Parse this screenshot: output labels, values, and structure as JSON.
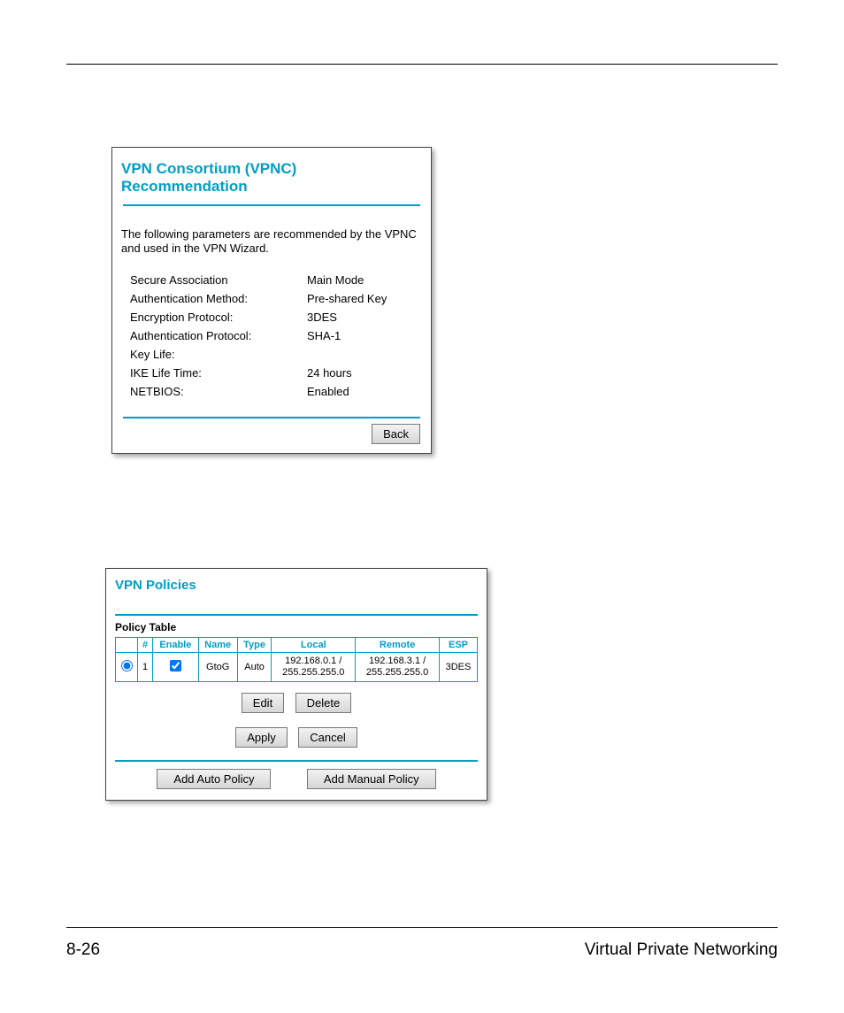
{
  "pageNumber": "8-26",
  "pageTitle": "Virtual Private Networking",
  "vpnc": {
    "title": "VPN Consortium (VPNC) Recommendation",
    "intro": "The following parameters are recommended by the VPNC and used in the VPN Wizard.",
    "rows": [
      {
        "k": "Secure Association",
        "v": "Main Mode"
      },
      {
        "k": "Authentication Method:",
        "v": "Pre-shared Key"
      },
      {
        "k": "Encryption Protocol:",
        "v": "3DES"
      },
      {
        "k": "Authentication Protocol:",
        "v": "SHA-1"
      },
      {
        "k": "Key Life:",
        "v": ""
      },
      {
        "k": "IKE Life Time:",
        "v": "24 hours"
      },
      {
        "k": "NETBIOS:",
        "v": "Enabled"
      }
    ],
    "back": "Back"
  },
  "policies": {
    "title": "VPN Policies",
    "tableLabel": "Policy Table",
    "headers": {
      "sel": "",
      "num": "#",
      "enable": "Enable",
      "name": "Name",
      "type": "Type",
      "local": "Local",
      "remote": "Remote",
      "esp": "ESP"
    },
    "row": {
      "num": "1",
      "name": "GtoG",
      "type": "Auto",
      "localA": "192.168.0.1 /",
      "localB": "255.255.255.0",
      "remoteA": "192.168.3.1 /",
      "remoteB": "255.255.255.0",
      "esp": "3DES"
    },
    "buttons": {
      "edit": "Edit",
      "delete": "Delete",
      "apply": "Apply",
      "cancel": "Cancel",
      "addAuto": "Add Auto Policy",
      "addManual": "Add Manual Policy"
    }
  }
}
